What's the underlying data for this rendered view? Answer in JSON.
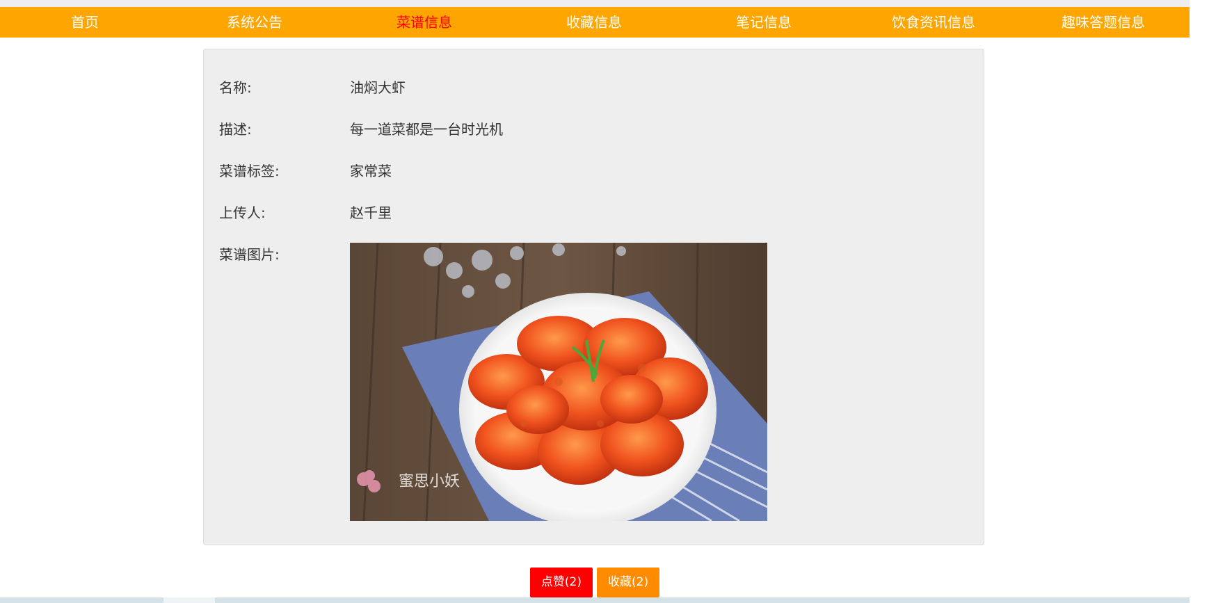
{
  "nav": {
    "items": [
      {
        "label": "首页"
      },
      {
        "label": "系统公告"
      },
      {
        "label": "菜谱信息"
      },
      {
        "label": "收藏信息"
      },
      {
        "label": "笔记信息"
      },
      {
        "label": "饮食资讯信息"
      },
      {
        "label": "趣味答题信息"
      }
    ],
    "active_index": 2
  },
  "recipe": {
    "name_label": "名称:",
    "name": "油焖大虾",
    "desc_label": "描述:",
    "desc": "每一道菜都是一台时光机",
    "tag_label": "菜谱标签:",
    "tag": "家常菜",
    "uploader_label": "上传人:",
    "uploader": "赵千里",
    "image_label": "菜谱图片:",
    "image_watermark": "蜜思小妖"
  },
  "actions": {
    "like_label": "点赞(2)",
    "favorite_label": "收藏(2)"
  },
  "colors": {
    "nav_bg": "#ffa500",
    "nav_active": "#ff0000",
    "like_bg": "#ff0000",
    "favorite_bg": "#ff8c00"
  }
}
